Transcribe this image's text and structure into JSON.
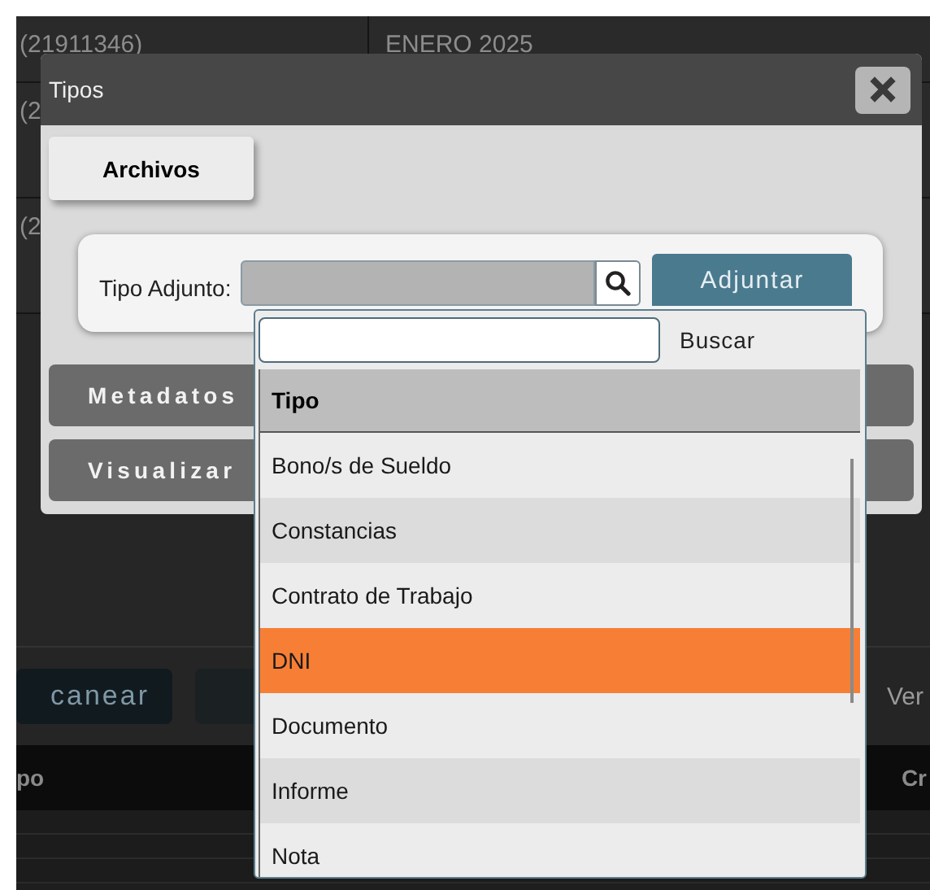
{
  "background": {
    "rows": [
      {
        "cells": [
          "(21911346)",
          "ENERO 2025"
        ]
      },
      {
        "cells": [
          "(2"
        ]
      },
      {
        "cells": [
          "(2"
        ]
      }
    ],
    "toolbar": {
      "buttons": [
        {
          "kind": "text",
          "label": "canear"
        },
        {
          "kind": "blank"
        }
      ],
      "link": "Ver"
    },
    "table": {
      "columns": [
        "po",
        "Cr"
      ]
    }
  },
  "dialog": {
    "title": "Tipos",
    "tabs": [
      {
        "label": "Archivos",
        "selected": true
      }
    ],
    "field_label": "Tipo Adjunto:",
    "attach_button": "Adjuntar",
    "sections": [
      "Metadatos",
      "Visualizar"
    ]
  },
  "dropdown": {
    "search_button": "Buscar",
    "column": "Tipo",
    "options": [
      {
        "label": "Bono/s de Sueldo",
        "selected": false
      },
      {
        "label": "Constancias",
        "selected": false
      },
      {
        "label": "Contrato de Trabajo",
        "selected": false
      },
      {
        "label": "DNI",
        "selected": true
      },
      {
        "label": "Documento",
        "selected": false
      },
      {
        "label": "Informe",
        "selected": false
      },
      {
        "label": "Nota",
        "selected": false
      }
    ]
  }
}
